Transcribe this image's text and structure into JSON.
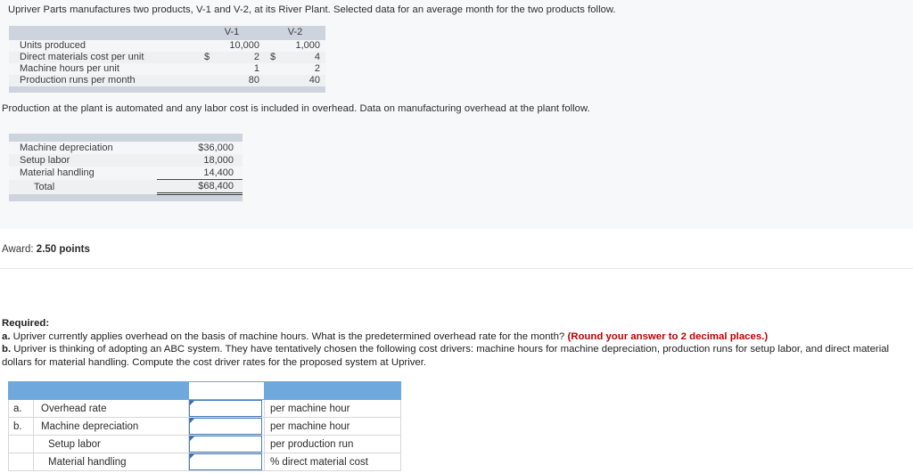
{
  "intro": {
    "paragraph_1": "Upriver Parts manufactures two products, V-1 and V-2, at its River Plant. Selected data for an average month for the two products follow.",
    "paragraph_2": "Production at the plant is automated and any labor cost is included in overhead. Data on manufacturing overhead at the plant follow."
  },
  "product_table": {
    "headers": [
      "",
      "V-1",
      "V-2"
    ],
    "rows": [
      {
        "label": "Units produced",
        "v1_cur": "",
        "v1": "10,000",
        "v2_cur": "",
        "v2": "1,000"
      },
      {
        "label": "Direct materials cost per unit",
        "v1_cur": "$",
        "v1": "2",
        "v2_cur": "$",
        "v2": "4"
      },
      {
        "label": "Machine hours per unit",
        "v1_cur": "",
        "v1": "1",
        "v2_cur": "",
        "v2": "2"
      },
      {
        "label": "Production runs per month",
        "v1_cur": "",
        "v1": "80",
        "v2_cur": "",
        "v2": "40"
      }
    ]
  },
  "overhead_table": {
    "rows": [
      {
        "label": "Machine depreciation",
        "amount": "$36,000"
      },
      {
        "label": "Setup labor",
        "amount": "18,000"
      },
      {
        "label": "Material handling",
        "amount": "14,400"
      }
    ],
    "total": {
      "label": "Total",
      "amount": "$68,400"
    }
  },
  "award": {
    "label": "Award:",
    "value": "2.50 points"
  },
  "required": {
    "heading": "Required:",
    "item_a_letter": "a.",
    "item_a_text": "Upriver currently applies overhead on the basis of machine hours. What is the predetermined overhead rate for the month?",
    "item_a_note": "(Round your answer to 2 decimal places.)",
    "item_b_letter": "b.",
    "item_b_text": "Upriver is thinking of adopting an ABC system. They have tentatively chosen the following cost drivers: machine hours for machine depreciation, production runs for setup labor, and direct material dollars for material handling. Compute the cost driver rates for the proposed system at Upriver."
  },
  "answer_table": {
    "header_color": "#6fa8dc",
    "headers": [
      "",
      "",
      "",
      ""
    ],
    "rows": [
      {
        "ref": "a.",
        "name": "Overhead rate",
        "value": "",
        "placeholder": "",
        "unit": "per machine hour",
        "indent": false
      },
      {
        "ref": "b.",
        "name": "Machine depreciation",
        "value": "",
        "placeholder": "",
        "unit": "per machine hour",
        "indent": false
      },
      {
        "ref": "",
        "name": "Setup labor",
        "value": "",
        "placeholder": "",
        "unit": "per production run",
        "indent": true
      },
      {
        "ref": "",
        "name": "Material handling",
        "value": "",
        "placeholder": "",
        "unit": "% direct material cost",
        "indent": true
      }
    ]
  }
}
